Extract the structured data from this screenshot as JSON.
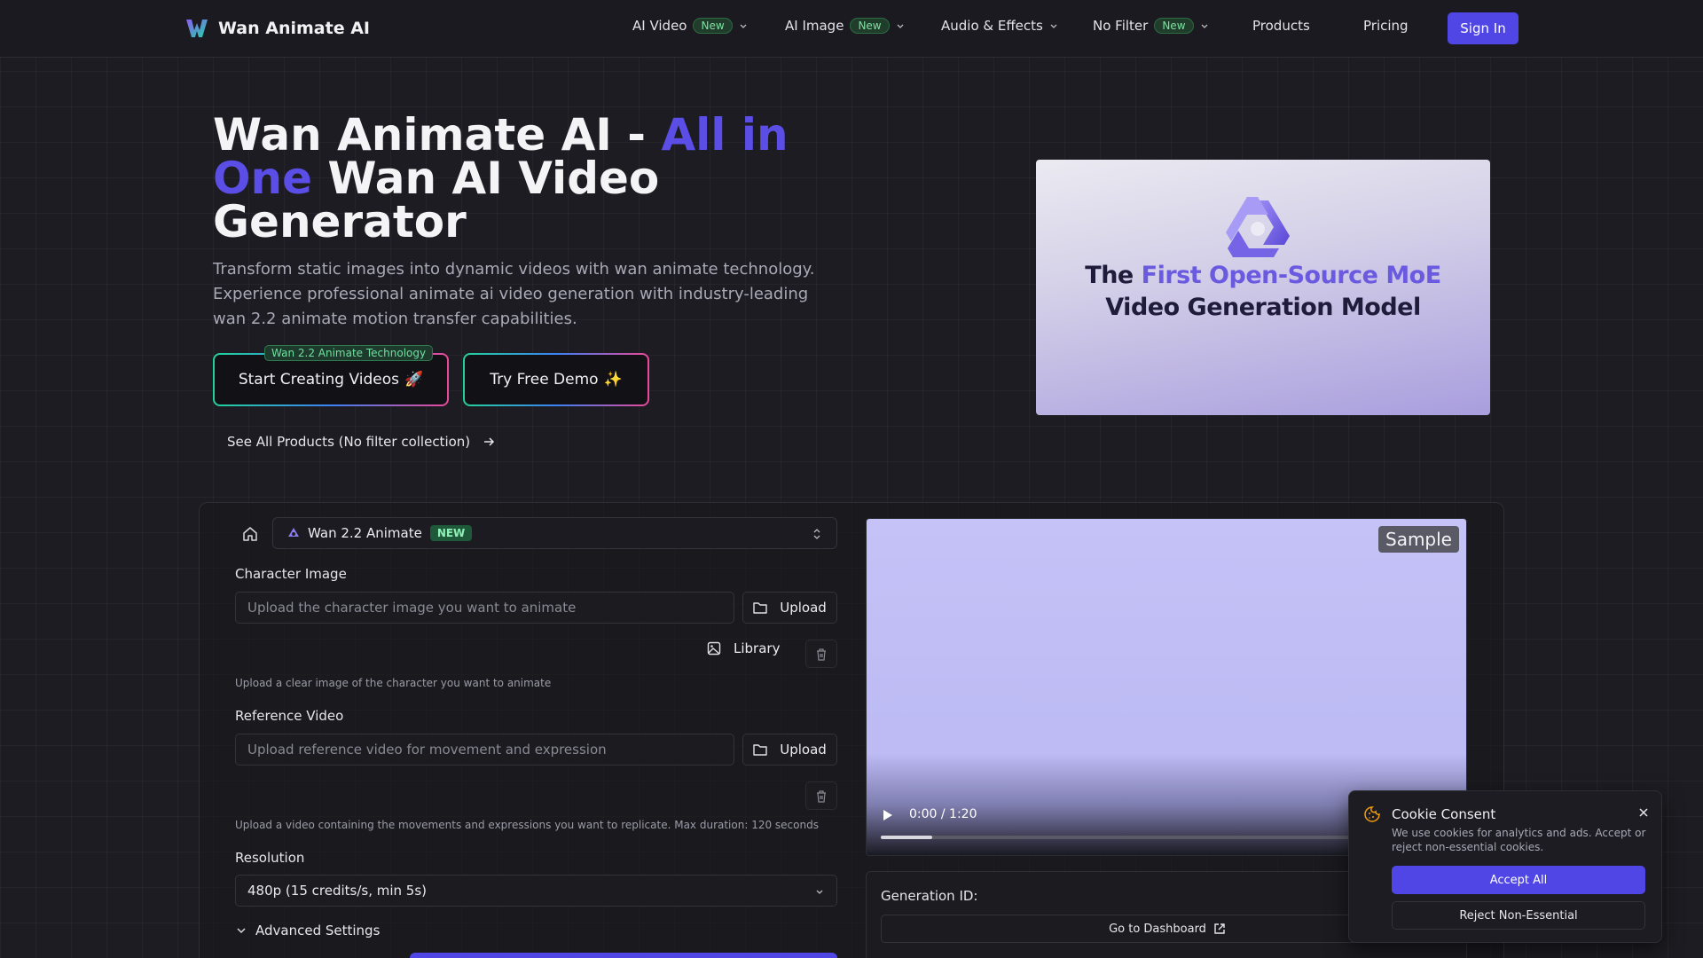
{
  "nav": {
    "brand": "Wan Animate AI",
    "items": [
      {
        "label": "AI Video",
        "badge": "New"
      },
      {
        "label": "AI Image",
        "badge": "New"
      },
      {
        "label": "Audio & Effects"
      },
      {
        "label": "No Filter",
        "badge": "New"
      },
      {
        "label": "Products"
      },
      {
        "label": "Pricing"
      }
    ],
    "signin": "Sign In"
  },
  "hero": {
    "title_pre": "Wan Animate AI - ",
    "title_highlight": "All in One",
    "title_post": " Wan AI Video Generator",
    "description": "Transform static images into dynamic videos with wan animate technology. Experience professional animate ai video generation with industry-leading wan 2.2 animate motion transfer capabilities.",
    "cta_primary": "Start Creating Videos",
    "cta_primary_emoji": "🚀",
    "cta_badge": "Wan 2.2 Animate Technology",
    "cta_secondary": "Try Free Demo",
    "cta_secondary_emoji": "✨",
    "see_all": "See All Products (No filter collection)",
    "image_line1_pre": "The ",
    "image_line1_accent": "First Open-Source MoE",
    "image_line2": "Video Generation Model"
  },
  "generator": {
    "model": "Wan 2.2 Animate",
    "model_badge": "NEW",
    "character_label": "Character Image",
    "character_placeholder": "Upload the character image you want to animate",
    "character_hint": "Upload a clear image of the character you want to animate",
    "reference_label": "Reference Video",
    "reference_placeholder": "Upload reference video for movement and expression",
    "reference_hint": "Upload a video containing the movements and expressions you want to replicate. Max duration: 120 seconds",
    "upload_label": "Upload",
    "library_label": "Library",
    "resolution_label": "Resolution",
    "resolution_value": "480p (15 credits/s, min 5s)",
    "advanced_label": "Advanced Settings"
  },
  "video": {
    "sample_tag": "Sample",
    "time": "0:00 / 1:20",
    "progress": 0.09,
    "generation_id_label": "Generation ID:",
    "dashboard_label": "Go to Dashboard"
  },
  "cookie": {
    "title": "Cookie Consent",
    "text": "We use cookies for analytics and ads. Accept or reject non-essential cookies.",
    "accept": "Accept All",
    "reject": "Reject Non-Essential"
  },
  "colors": {
    "accent": "#4f46e5",
    "highlight": "#5b4ee6",
    "badge_green": "#7fe0a2",
    "background": "#1c1c22"
  },
  "icons": [
    "brand-logo",
    "chevron-down-icon",
    "home-icon",
    "model-logo-icon",
    "updown-icon",
    "folder-icon",
    "image-icon",
    "trash-icon",
    "arrow-right-icon",
    "play-icon",
    "external-link-icon",
    "cookie-icon",
    "close-icon"
  ]
}
